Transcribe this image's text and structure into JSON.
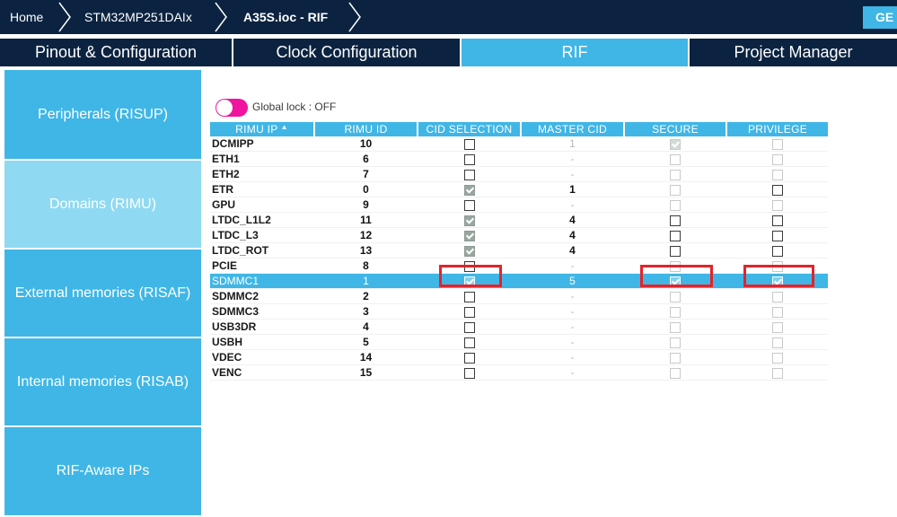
{
  "breadcrumb": {
    "home": "Home",
    "device": "STM32MP251DAIx",
    "file": "A35S.ioc - RIF",
    "generate": "GE"
  },
  "tabs": [
    {
      "label": "Pinout & Configuration",
      "active": false
    },
    {
      "label": "Clock Configuration",
      "active": false
    },
    {
      "label": "RIF",
      "active": true
    },
    {
      "label": "Project Manager",
      "active": false
    }
  ],
  "sidebar": {
    "items": [
      {
        "label": "Peripherals (RISUP)",
        "active": false
      },
      {
        "label": "Domains (RIMU)",
        "active": true
      },
      {
        "label": "External memories (RISAF)",
        "active": false
      },
      {
        "label": "Internal memories (RISAB)",
        "active": false
      },
      {
        "label": "RIF-Aware IPs",
        "active": false
      }
    ]
  },
  "global_lock": {
    "label": "Global lock : OFF",
    "on": false
  },
  "table": {
    "headers": [
      "RIMU IP",
      "RIMU ID",
      "CID SELECTION",
      "MASTER CID",
      "SECURE",
      "PRIVILEGE"
    ],
    "sort_indicator": "▲",
    "rows": [
      {
        "ip": "DCMIPP",
        "id": "10",
        "cid_sel": "unchecked",
        "master_cid": "1",
        "master_dim": true,
        "secure": "dimchecked",
        "privilege": "dim",
        "selected": false
      },
      {
        "ip": "ETH1",
        "id": "6",
        "cid_sel": "unchecked",
        "master_cid": "-",
        "master_dim": true,
        "secure": "dim",
        "privilege": "dim",
        "selected": false
      },
      {
        "ip": "ETH2",
        "id": "7",
        "cid_sel": "unchecked",
        "master_cid": "-",
        "master_dim": true,
        "secure": "dim",
        "privilege": "dim",
        "selected": false
      },
      {
        "ip": "ETR",
        "id": "0",
        "cid_sel": "checked",
        "master_cid": "1",
        "master_dim": false,
        "secure": "dim",
        "privilege": "unchecked",
        "selected": false
      },
      {
        "ip": "GPU",
        "id": "9",
        "cid_sel": "unchecked",
        "master_cid": "-",
        "master_dim": true,
        "secure": "dim",
        "privilege": "dim",
        "selected": false
      },
      {
        "ip": "LTDC_L1L2",
        "id": "11",
        "cid_sel": "checked",
        "master_cid": "4",
        "master_dim": false,
        "secure": "unchecked",
        "privilege": "unchecked",
        "selected": false
      },
      {
        "ip": "LTDC_L3",
        "id": "12",
        "cid_sel": "checked",
        "master_cid": "4",
        "master_dim": false,
        "secure": "unchecked",
        "privilege": "unchecked",
        "selected": false
      },
      {
        "ip": "LTDC_ROT",
        "id": "13",
        "cid_sel": "checked",
        "master_cid": "4",
        "master_dim": false,
        "secure": "unchecked",
        "privilege": "unchecked",
        "selected": false
      },
      {
        "ip": "PCIE",
        "id": "8",
        "cid_sel": "unchecked",
        "master_cid": "-",
        "master_dim": true,
        "secure": "dim",
        "privilege": "dim",
        "selected": false
      },
      {
        "ip": "SDMMC1",
        "id": "1",
        "cid_sel": "checked",
        "master_cid": "5",
        "master_dim": false,
        "secure": "checked",
        "privilege": "checked",
        "selected": true
      },
      {
        "ip": "SDMMC2",
        "id": "2",
        "cid_sel": "unchecked",
        "master_cid": "-",
        "master_dim": true,
        "secure": "dim",
        "privilege": "dim",
        "selected": false
      },
      {
        "ip": "SDMMC3",
        "id": "3",
        "cid_sel": "unchecked",
        "master_cid": "-",
        "master_dim": true,
        "secure": "dim",
        "privilege": "dim",
        "selected": false
      },
      {
        "ip": "USB3DR",
        "id": "4",
        "cid_sel": "unchecked",
        "master_cid": "-",
        "master_dim": true,
        "secure": "dim",
        "privilege": "dim",
        "selected": false
      },
      {
        "ip": "USBH",
        "id": "5",
        "cid_sel": "unchecked",
        "master_cid": "-",
        "master_dim": true,
        "secure": "dim",
        "privilege": "dim",
        "selected": false
      },
      {
        "ip": "VDEC",
        "id": "14",
        "cid_sel": "unchecked",
        "master_cid": "-",
        "master_dim": true,
        "secure": "dim",
        "privilege": "dim",
        "selected": false
      },
      {
        "ip": "VENC",
        "id": "15",
        "cid_sel": "unchecked",
        "master_cid": "-",
        "master_dim": true,
        "secure": "dim",
        "privilege": "dim",
        "selected": false
      }
    ]
  },
  "colors": {
    "navy": "#0b2340",
    "accent": "#3fb6e6",
    "accent_light": "#8fd9f2",
    "toggle": "#f014a0",
    "highlight_box": "#e3232a"
  },
  "icons": [
    "chevron-right-icon",
    "toggle-switch",
    "sort-up-icon",
    "checkbox"
  ]
}
